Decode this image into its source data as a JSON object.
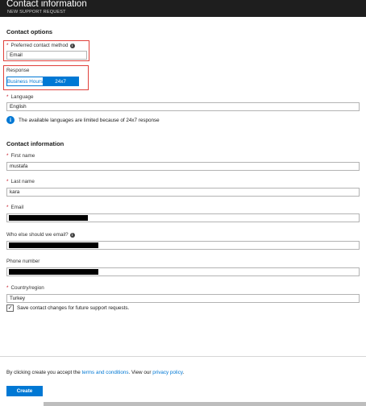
{
  "window": {
    "title": "Contact information",
    "subtitle": "NEW SUPPORT REQUEST"
  },
  "contact_options": {
    "heading": "Contact options",
    "preferred_method_label": "Preferred contact method",
    "preferred_method_value": "Email",
    "response_label": "Response",
    "response_options": [
      "Business Hours",
      "24x7"
    ],
    "response_selected": "24x7",
    "language_label": "Language",
    "language_value": "English",
    "language_note": "The available languages are limited because of 24x7 response"
  },
  "contact_information": {
    "heading": "Contact information",
    "first_name_label": "First name",
    "first_name_value": "mustafa",
    "last_name_label": "Last name",
    "last_name_value": "kara",
    "email_label": "Email",
    "cc_label": "Who else should we email?",
    "phone_label": "Phone number",
    "country_label": "Country/region",
    "country_value": "Turkey",
    "save_checkbox_label": "Save contact changes for future support requests.",
    "save_checked": true
  },
  "footer": {
    "consent_prefix": "By clicking create you accept the ",
    "terms_link": "terms and conditions",
    "consent_middle": ". View our ",
    "privacy_link": "privacy policy",
    "consent_suffix": ".",
    "create_label": "Create"
  },
  "colors": {
    "accent": "#0078d4",
    "required": "#c50f1f",
    "highlight": "#e0403a",
    "titlebar": "#1e1e1e"
  }
}
